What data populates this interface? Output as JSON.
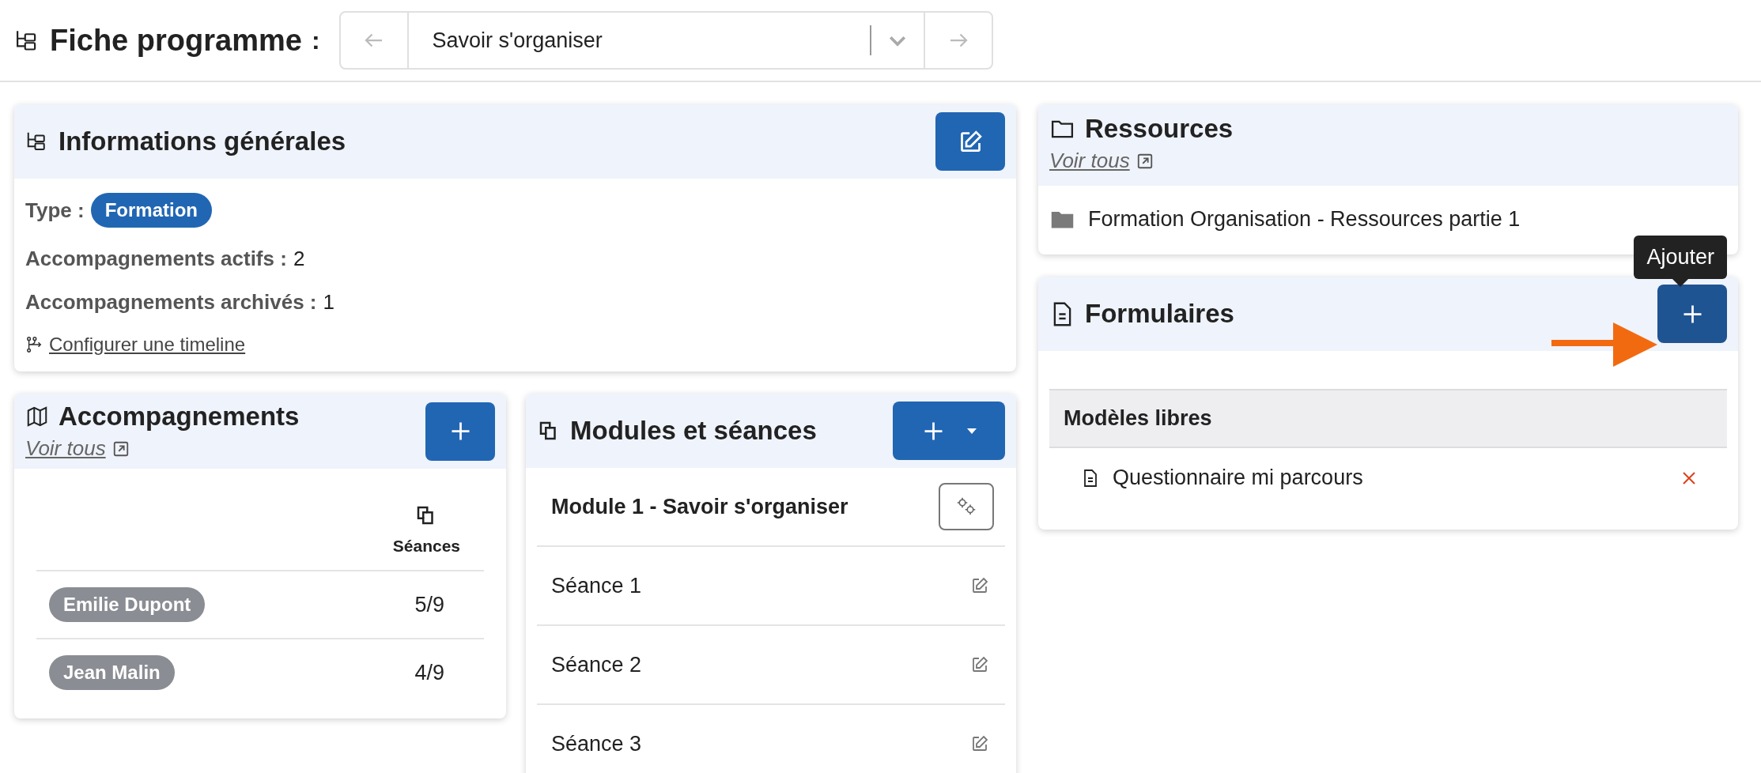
{
  "header": {
    "title": "Fiche programme",
    "separator": ":",
    "selector": {
      "value": "Savoir s'organiser"
    }
  },
  "info": {
    "title": "Informations générales",
    "type_label": "Type :",
    "type_badge": "Formation",
    "fields": [
      {
        "label": "Accompagnements actifs :",
        "value": "2"
      },
      {
        "label": "Accompagnements archivés :",
        "value": "1"
      }
    ],
    "link": "Configurer une timeline"
  },
  "accompagnements": {
    "title": "Accompagnements",
    "link": "Voir tous",
    "column": "Séances",
    "rows": [
      {
        "name": "Emilie Dupont",
        "value": "5/9"
      },
      {
        "name": "Jean Malin",
        "value": "4/9"
      }
    ]
  },
  "modules": {
    "title": "Modules et séances",
    "module": "Module 1 - Savoir s'organiser",
    "sessions": [
      "Séance 1",
      "Séance 2",
      "Séance 3"
    ]
  },
  "ressources": {
    "title": "Ressources",
    "link": "Voir tous",
    "items": [
      "Formation Organisation - Ressources partie 1"
    ]
  },
  "formulaires": {
    "title": "Formulaires",
    "tooltip": "Ajouter",
    "group": "Modèles libres",
    "items": [
      "Questionnaire mi parcours"
    ]
  }
}
